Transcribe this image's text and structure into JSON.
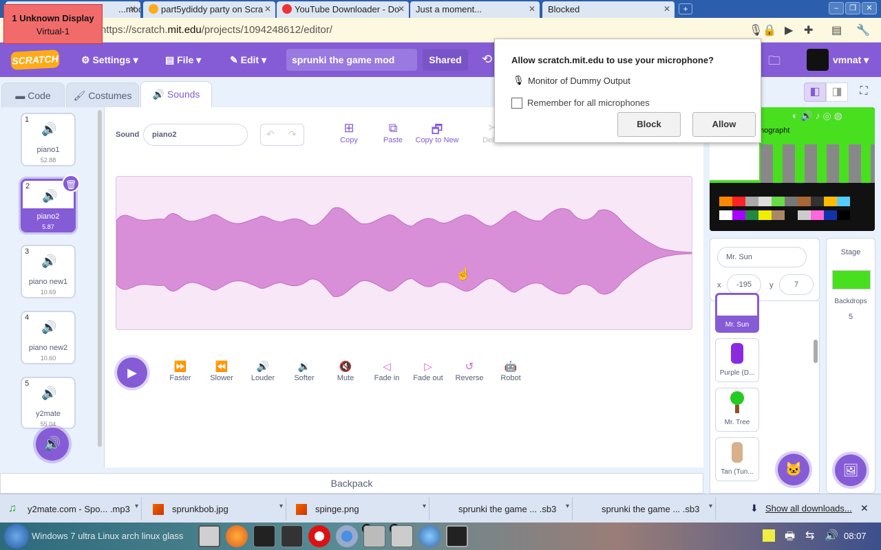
{
  "badge": {
    "line1": "1  Unknown Display",
    "line2": "Virtual-1"
  },
  "browser_tabs": [
    {
      "title": "...mod on",
      "color": "#ffab19"
    },
    {
      "title": "part5ydiddy party on Scra",
      "color": "#ffab19"
    },
    {
      "title": "YouTube Downloader - Do",
      "color": "#e33"
    },
    {
      "title": "Just a moment...",
      "color": ""
    },
    {
      "title": "Blocked",
      "color": ""
    }
  ],
  "address": {
    "prefix": "https://scratch.",
    "host": "mit.edu",
    "path": "/projects/1094248612/editor/"
  },
  "menubar": {
    "logo": "SCRATCH",
    "settings": "Settings",
    "file": "File",
    "edit": "Edit",
    "project_title": "sprunki the game mod",
    "shared": "Shared",
    "username": "vmnat"
  },
  "editor_tabs": {
    "code": "Code",
    "costumes": "Costumes",
    "sounds": "Sounds"
  },
  "sounds": [
    {
      "num": "1",
      "name": "piano1",
      "duration": "52.88"
    },
    {
      "num": "2",
      "name": "piano2",
      "duration": "5.87"
    },
    {
      "num": "3",
      "name": "piano new1",
      "duration": "10.69"
    },
    {
      "num": "4",
      "name": "piano new2",
      "duration": "10.60"
    },
    {
      "num": "5",
      "name": "y2mate",
      "duration": "55.04"
    }
  ],
  "sound_editor": {
    "sound_label": "Sound",
    "sound_name": "piano2",
    "tools": {
      "copy": "Copy",
      "paste": "Paste",
      "copy_to_new": "Copy to New",
      "delete": "Delete"
    },
    "effects": [
      "Faster",
      "Slower",
      "Louder",
      "Softer",
      "Mute",
      "Fade in",
      "Fade out",
      "Reverse",
      "Robot"
    ]
  },
  "backpack": "Backpack",
  "stage_overlay_text": "mographt",
  "sprite_info": {
    "name": "Mr. Sun",
    "x_label": "x",
    "x": "-195",
    "y_label": "y",
    "y": "7"
  },
  "sprites": [
    {
      "name": "Mr. Sun",
      "selected": true
    },
    {
      "name": "Purple (D..."
    },
    {
      "name": "Mr. Tree"
    },
    {
      "name": "Tan (Tun..."
    }
  ],
  "stage_panel": {
    "title": "Stage",
    "backdrops_label": "Backdrops",
    "backdrops_count": "5"
  },
  "permission": {
    "question": "Allow scratch.mit.edu to use your microphone?",
    "device": "Monitor of Dummy Output",
    "remember": "Remember for all microphones",
    "block": "Block",
    "allow": "Allow"
  },
  "downloads": [
    {
      "name": "y2mate.com - Spo...  .mp3"
    },
    {
      "name": "sprunkbob.jpg"
    },
    {
      "name": "spinge.png"
    },
    {
      "name": "sprunki the game ...  .sb3"
    },
    {
      "name": "sprunki the game ...  .sb3"
    }
  ],
  "show_all_downloads": "Show all downloads...",
  "taskbar": {
    "start_label": "Windows 7 ultra Linux arch linux glass",
    "clock": "08:07",
    "badge1": "2",
    "badge2": "2"
  },
  "colors": {
    "scratch_purple": "#855cd6",
    "sound_pink": "#cf63cf",
    "waveform_fill": "#d98fd8"
  }
}
